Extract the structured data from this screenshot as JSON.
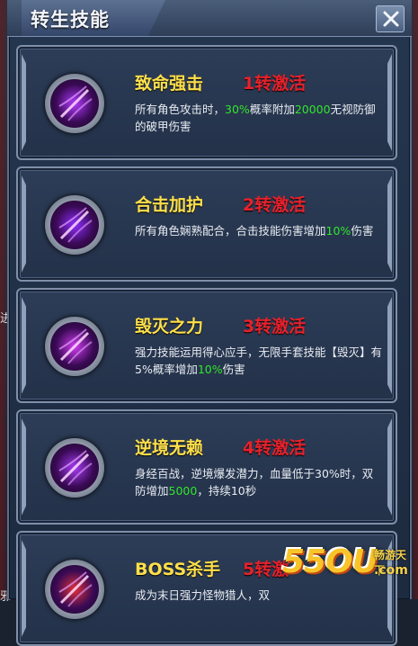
{
  "window": {
    "title": "转生技能",
    "close_glyph": "X"
  },
  "background": {
    "left_texts": [
      "进",
      "邪"
    ]
  },
  "skills": [
    {
      "name": "致命强击",
      "activation": "1转激活",
      "desc_parts": [
        "所有角色攻击时，",
        "30%",
        "概率附加",
        "20000",
        "无视防御的破甲伤害"
      ],
      "icon": "purple-slash-icon",
      "glow": "#b03aff"
    },
    {
      "name": "合击加护",
      "activation": "2转激活",
      "desc_parts": [
        "所有角色娴熟配合，合击技能伤害增加",
        "10%",
        "伤害"
      ],
      "icon": "purple-blade-icon",
      "glow": "#8e2dff"
    },
    {
      "name": "毁灭之力",
      "activation": "3转激活",
      "desc_parts": [
        "强力技能运用得心应手，无限手套技能【毁灭】有5%概率增加",
        "10%",
        "伤害"
      ],
      "icon": "purple-burst-icon",
      "glow": "#d03cf0"
    },
    {
      "name": "逆境无赖",
      "activation": "4转激活",
      "desc_parts": [
        "身经百战，逆境爆发潜力，血量低于30%时，双防增加",
        "5000",
        "，持续10秒"
      ],
      "icon": "purple-feather-icon",
      "glow": "#a73cf5"
    },
    {
      "name": "BOSS杀手",
      "activation": "5转激",
      "desc_parts": [
        "成为末日强力怪物猎人，双"
      ],
      "icon": "red-sphere-icon",
      "glow": "#e0303a"
    }
  ],
  "watermark": {
    "logo": "55OU",
    "sub1": "畅游天下",
    "sub2": ".com"
  }
}
